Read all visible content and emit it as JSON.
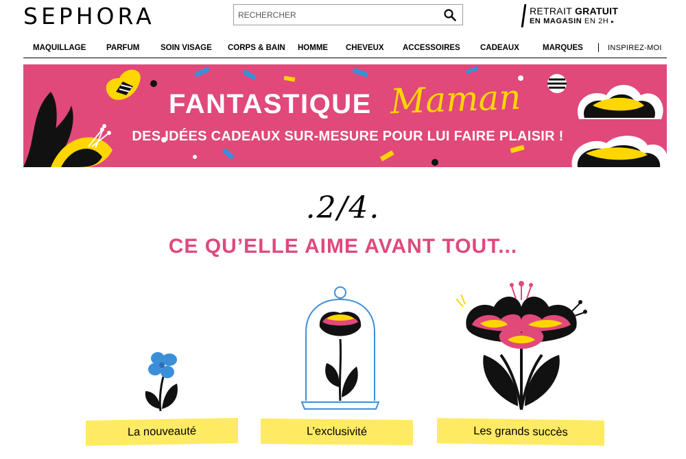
{
  "header": {
    "logo": "SEPHORA",
    "search_placeholder": "RECHERCHER",
    "retrait_line1_a": "RETRAIT ",
    "retrait_line1_b": "GRATUIT",
    "retrait_line2_a": "EN MAGASIN",
    "retrait_line2_b": " EN 2H",
    "retrait_arrow": "▸"
  },
  "nav": {
    "items": [
      "MAQUILLAGE",
      "PARFUM",
      "SOIN VISAGE",
      "CORPS & BAIN",
      "HOMME",
      "CHEVEUX",
      "ACCESSOIRES",
      "CADEAUX",
      "MARQUES"
    ],
    "inspirez": "INSPIREZ-MOI"
  },
  "banner": {
    "title_a": "FANTASTIQUE",
    "title_b": "Maman",
    "subtitle": "DES IDÉES CADEAUX SUR-MESURE POUR LUI FAIRE PLAISIR !"
  },
  "section": {
    "step": ".2/4.",
    "heading": "CE QU’ELLE AIME AVANT TOUT..."
  },
  "cards": [
    {
      "label": "La nouveauté"
    },
    {
      "label": "L’exclusivité"
    },
    {
      "label": "Les grands succès"
    }
  ],
  "colors": {
    "pink": "#e0497a",
    "yellow": "#ffd600",
    "label_yellow": "#ffea63",
    "blue": "#3b8fd8"
  }
}
